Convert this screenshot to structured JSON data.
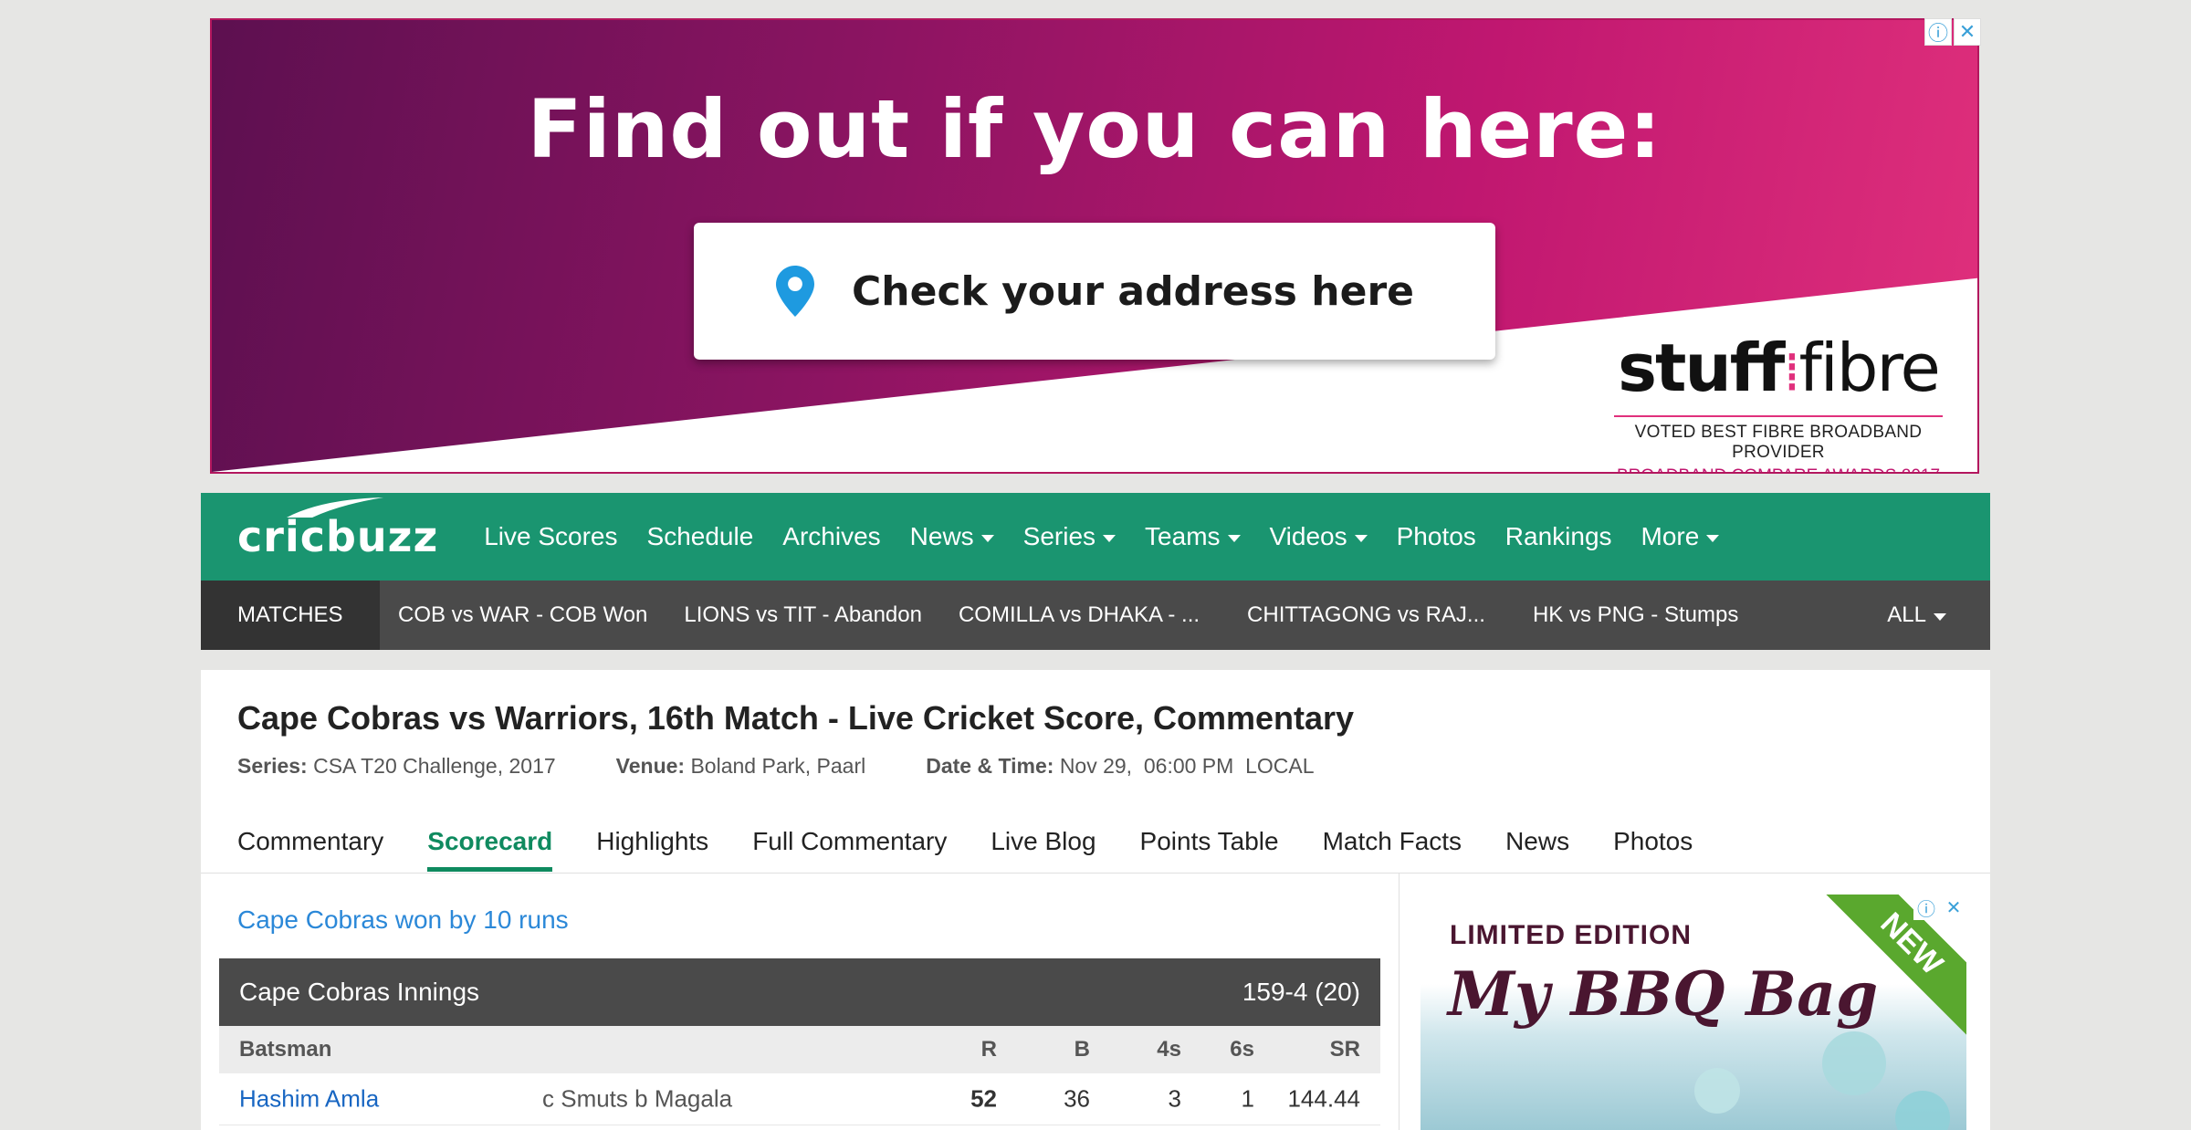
{
  "ad_banner": {
    "headline": "Find out if you can here:",
    "cta": "Check your address here",
    "brand_name_a": "stuff",
    "brand_name_b": "fibre",
    "award_line1": "VOTED BEST FIBRE BROADBAND PROVIDER",
    "award_line2": "BROADBAND COMPARE AWARDS 2017",
    "icons": [
      "ad-info-icon",
      "ad-close-icon"
    ]
  },
  "nav": {
    "logo": "cricbuzz",
    "items": [
      {
        "label": "Live Scores",
        "dropdown": false
      },
      {
        "label": "Schedule",
        "dropdown": false
      },
      {
        "label": "Archives",
        "dropdown": false
      },
      {
        "label": "News",
        "dropdown": true
      },
      {
        "label": "Series",
        "dropdown": true
      },
      {
        "label": "Teams",
        "dropdown": true
      },
      {
        "label": "Videos",
        "dropdown": true
      },
      {
        "label": "Photos",
        "dropdown": false
      },
      {
        "label": "Rankings",
        "dropdown": false
      },
      {
        "label": "More",
        "dropdown": true
      }
    ],
    "color": "#1a9570"
  },
  "matches": {
    "label": "MATCHES",
    "items": [
      "COB vs WAR - COB Won",
      "LIONS vs TIT - Abandon",
      "COMILLA vs DHAKA - ...",
      "CHITTAGONG vs RAJ...",
      "HK vs PNG - Stumps"
    ],
    "all_label": "ALL"
  },
  "match": {
    "title": "Cape Cobras vs Warriors, 16th Match - Live Cricket Score, Commentary",
    "series_label": "Series:",
    "series_value": "CSA T20 Challenge, 2017",
    "venue_label": "Venue:",
    "venue_value": "Boland Park, Paarl",
    "datetime_label": "Date & Time:",
    "datetime_value": "Nov 29,  06:00 PM  LOCAL"
  },
  "tabs": [
    {
      "label": "Commentary",
      "active": false
    },
    {
      "label": "Scorecard",
      "active": true
    },
    {
      "label": "Highlights",
      "active": false
    },
    {
      "label": "Full Commentary",
      "active": false
    },
    {
      "label": "Live Blog",
      "active": false
    },
    {
      "label": "Points Table",
      "active": false
    },
    {
      "label": "Match Facts",
      "active": false
    },
    {
      "label": "News",
      "active": false
    },
    {
      "label": "Photos",
      "active": false
    }
  ],
  "result": "Cape Cobras won by 10 runs",
  "innings": {
    "name": "Cape Cobras Innings",
    "score": "159-4 (20)",
    "headers": {
      "batsman": "Batsman",
      "r": "R",
      "b": "B",
      "fours": "4s",
      "sixes": "6s",
      "sr": "SR"
    },
    "rows": [
      {
        "batsman": "Hashim Amla",
        "dismissal": "c Smuts b Magala",
        "r": "52",
        "b": "36",
        "fours": "3",
        "sixes": "1",
        "sr": "144.44"
      }
    ]
  },
  "side_ad": {
    "line1": "LIMITED EDITION",
    "line2": "My BBQ Bag",
    "ribbon": "NEW",
    "icons": [
      "ad-info-icon",
      "ad-close-icon"
    ]
  }
}
